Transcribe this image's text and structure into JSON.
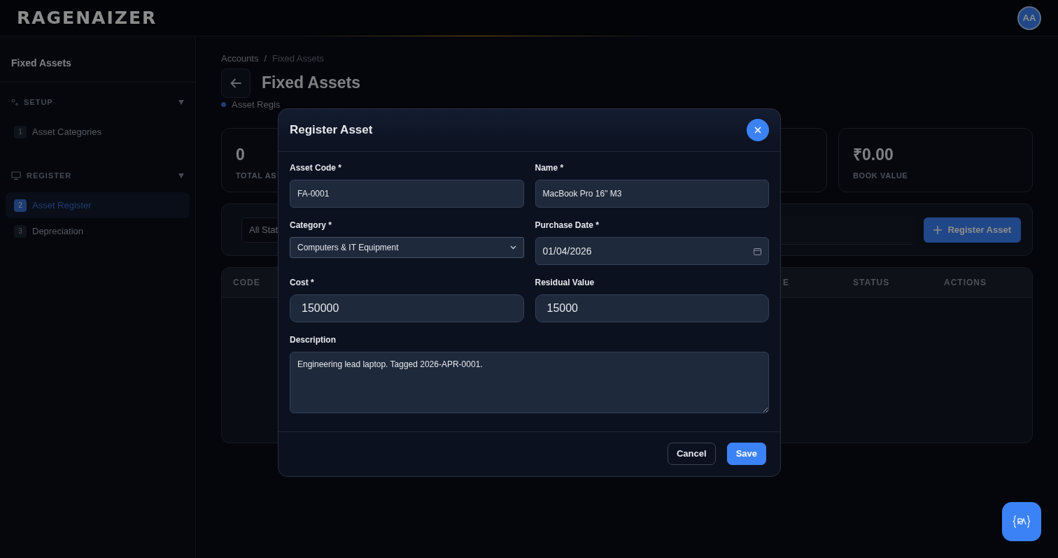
{
  "header": {
    "logo": "RAGENAIZER",
    "avatar": "AA"
  },
  "sidebar": {
    "title": "Fixed Assets",
    "sections": [
      {
        "label": "SETUP",
        "expanded": true,
        "items": [
          {
            "number": "1",
            "label": "Asset Categories",
            "selected": false
          }
        ]
      },
      {
        "label": "REGISTER",
        "expanded": true,
        "items": [
          {
            "number": "2",
            "label": "Asset Register",
            "selected": true
          },
          {
            "number": "3",
            "label": "Depreciation",
            "selected": false
          }
        ]
      }
    ]
  },
  "breadcrumb": {
    "items": [
      "Accounts",
      "Fixed Assets"
    ],
    "separator": "/"
  },
  "page": {
    "title": "Fixed Assets",
    "subtitle": "Asset Regis"
  },
  "stats": [
    {
      "value": "0",
      "label": "TOTAL AS"
    },
    {
      "value": "₹0.00",
      "label": "BOOK VALUE"
    }
  ],
  "filters": {
    "status_select": "All Stat",
    "register_button": "Register Asset"
  },
  "table": {
    "columns": [
      "CODE",
      "E",
      "STATUS",
      "ACTIONS"
    ]
  },
  "modal": {
    "title": "Register Asset",
    "fields": [
      {
        "kind": "text",
        "label": "Asset Code *",
        "value": "FA-0001"
      },
      {
        "kind": "text",
        "label": "Name *",
        "value": "MacBook Pro 16\" M3"
      },
      {
        "kind": "select",
        "label": "Category *",
        "value": "Computers & IT Equipment"
      },
      {
        "kind": "date",
        "label": "Purchase Date *",
        "value": "01/04/2026"
      },
      {
        "kind": "number",
        "label": "Cost *",
        "value": "150000"
      },
      {
        "kind": "number",
        "label": "Residual Value",
        "value": "15000"
      },
      {
        "kind": "textarea",
        "label": "Description",
        "value": "Engineering lead laptop. Tagged 2026-APR-0001."
      }
    ],
    "buttons": [
      {
        "label": "Cancel",
        "kind": "secondary"
      },
      {
        "label": "Save",
        "kind": "primary"
      }
    ]
  }
}
